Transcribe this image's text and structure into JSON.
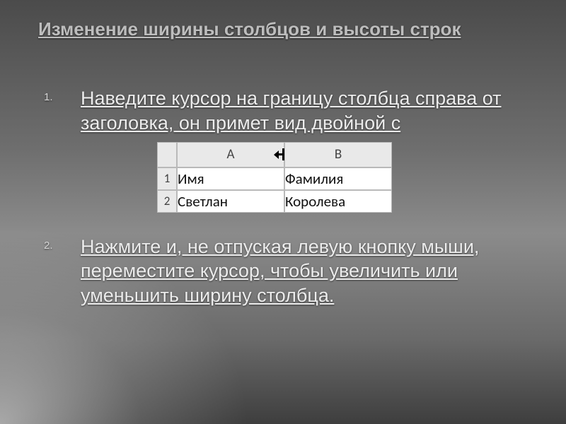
{
  "title": "Изменение ширины столбцов и высоты строк",
  "steps": [
    "Наведите курсор на границу столбца справа от заголовка, он примет вид двойной с",
    "Нажмите и, не отпуская левую кнопку мыши, переместите курсор, чтобы увеличить или уменьшить ширину столбца."
  ],
  "excel": {
    "columns": [
      "A",
      "B"
    ],
    "rows": [
      {
        "num": "1",
        "cells": [
          "Имя",
          "Фамилия"
        ]
      },
      {
        "num": "2",
        "cells": [
          "Светлан",
          "Королева"
        ]
      }
    ],
    "resize_cursor_between": "A|B"
  }
}
